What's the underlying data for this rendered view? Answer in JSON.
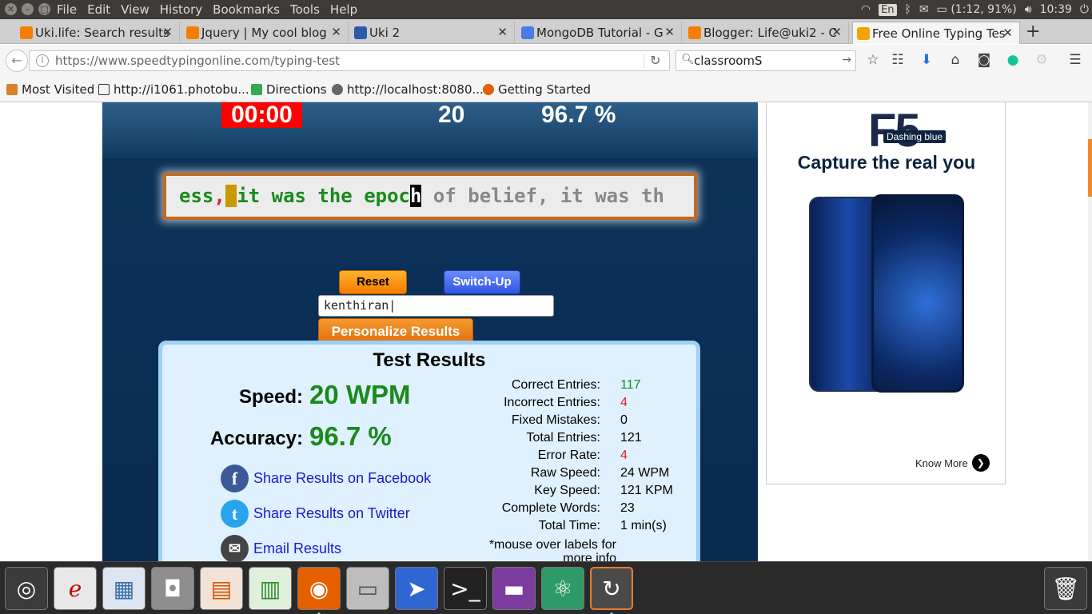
{
  "top_panel": {
    "menu": [
      "File",
      "Edit",
      "View",
      "History",
      "Bookmarks",
      "Tools",
      "Help"
    ],
    "lang": "En",
    "battery": "(1:12, 91%)",
    "time": "10:39"
  },
  "tabs": [
    {
      "title": "Uki.life: Search results",
      "favicon": "blogger-icon"
    },
    {
      "title": "Jquery | My cool blog",
      "favicon": "blogger-icon"
    },
    {
      "title": "Uki 2",
      "favicon": "uki-icon"
    },
    {
      "title": "MongoDB Tutorial - G",
      "favicon": "docs-icon"
    },
    {
      "title": "Blogger: Life@uki2 - C",
      "favicon": "blogger-icon"
    },
    {
      "title": "Free Online Typing Tes",
      "favicon": "typing-icon",
      "active": true
    }
  ],
  "nav": {
    "url": "https://www.speedtypingonline.com/typing-test",
    "search_value": "classroomS"
  },
  "bookmarks": [
    {
      "label": "Most Visited"
    },
    {
      "label": "http://i1061.photobu..."
    },
    {
      "label": "Directions"
    },
    {
      "label": "http://localhost:8080..."
    },
    {
      "label": "Getting Started"
    }
  ],
  "typing_test": {
    "timer": "00:00",
    "wpm_top": "20",
    "accuracy_top": "96.7 %",
    "text": {
      "typed_1": "ess",
      "typed_error": ",",
      "cursor_error": "_",
      "typed_2": "it was the epoc",
      "current": "h",
      "untyped": " of belief, it was th"
    },
    "reset_label": "Reset",
    "switch_label": "Switch-Up",
    "name_value": "kenthiran",
    "personalize_label": "Personalize Results"
  },
  "results": {
    "title": "Test Results",
    "speed_label": "Speed:",
    "speed_value": "20 WPM",
    "accuracy_label": "Accuracy:",
    "accuracy_value": "96.7 %",
    "share_facebook": "Share Results on Facebook",
    "share_twitter": "Share Results on Twitter",
    "share_email": "Email Results",
    "stats": [
      {
        "label": "Correct Entries:",
        "value": "117",
        "color": "#1a8a1a"
      },
      {
        "label": "Incorrect Entries:",
        "value": "4",
        "color": "#e02020"
      },
      {
        "label": "Fixed Mistakes:",
        "value": "0",
        "color": "#000000"
      },
      {
        "label": "Total Entries:",
        "value": "121",
        "color": "#000000"
      },
      {
        "label": "Error Rate:",
        "value": "4",
        "color": "#e02020"
      },
      {
        "label": "Raw Speed:",
        "value": "24 WPM",
        "color": "#000000"
      },
      {
        "label": "Key Speed:",
        "value": "121 KPM",
        "color": "#000000"
      },
      {
        "label": "Complete Words:",
        "value": "23",
        "color": "#000000"
      },
      {
        "label": "Total Time:",
        "value": "1 min(s)",
        "color": "#000000"
      }
    ],
    "footnote": "*mouse over labels for more info"
  },
  "ad": {
    "brand": "F5",
    "badge": "Dashing blue",
    "slogan": "Capture the real you",
    "cta": "Know More"
  },
  "colors": {
    "accent_orange": "#f57c00",
    "timer_red": "#ff0000",
    "typed_green": "#1a8a1a",
    "error_red": "#e02020"
  }
}
